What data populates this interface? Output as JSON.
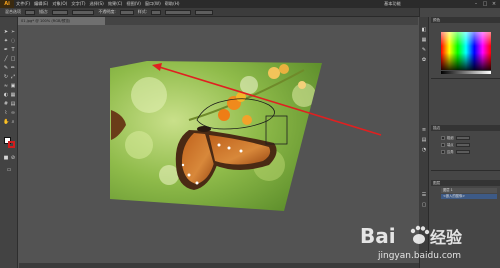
{
  "menubar": {
    "logo": "Ai",
    "items": [
      "文件(F)",
      "编辑(E)",
      "对象(O)",
      "文字(T)",
      "选择(S)",
      "效果(C)",
      "视图(V)",
      "窗口(W)",
      "帮助(H)"
    ],
    "workspace": "基本功能",
    "window_controls": [
      "–",
      "□",
      "×"
    ]
  },
  "controlbar": {
    "label_left": "混合选项",
    "label_fill": "描边:",
    "label_opacity": "不透明度:",
    "label_style": "样式:"
  },
  "document": {
    "tab_title": "01.jpg* @ 100% (RGB/预览)"
  },
  "panels": {
    "color_title": "颜色",
    "stroke_title": "描边",
    "layers_title": "图层",
    "layer_rows": [
      "图层 1",
      "<嵌入的图像>"
    ],
    "stroke_rows": [
      "粗细",
      "端点",
      "边角"
    ]
  },
  "watermark": {
    "brand": "Bai",
    "brand2": "经验",
    "url": "jingyan.baidu.com"
  },
  "colors": {
    "stroke_color": "#d01d1d",
    "arrow_color": "#e02020",
    "accent": "#f7a21b"
  }
}
